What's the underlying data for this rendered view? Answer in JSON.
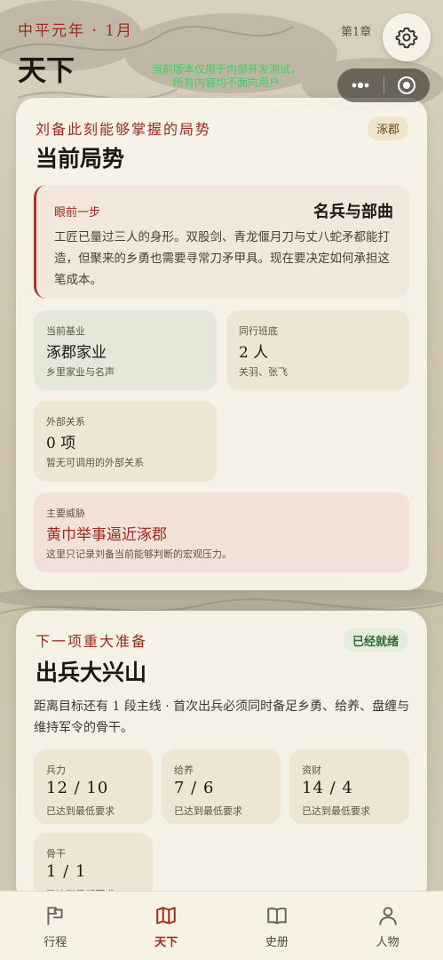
{
  "header": {
    "era": "中平元年 · 1月",
    "chapter": "第1章",
    "title": "天下",
    "dev_notice": "当前版本仅用于内部开发测试，\n所有内容均不面向用户",
    "icons": {
      "settings": "gear-icon",
      "more": "more-dots-icon",
      "close": "mini-program-close-icon"
    }
  },
  "situation": {
    "kicker": "刘备此刻能够掌握的局势",
    "title": "当前局势",
    "badge": "涿郡",
    "next_step": {
      "label": "眼前一步",
      "title": "名兵与部曲",
      "text": "工匠已量过三人的身形。双股剑、青龙偃月刀与丈八蛇矛都能打造，但聚来的乡勇也需要寻常刀矛甲具。现在要决定如何承担这笔成本。"
    },
    "base": {
      "label": "当前基业",
      "value": "涿郡家业",
      "sub": "乡里家业与名声"
    },
    "companions": {
      "label": "同行班底",
      "value": "2 人",
      "sub": "关羽、张飞"
    },
    "relations": {
      "label": "外部关系",
      "value": "0 项",
      "sub": "暂无可调用的外部关系"
    },
    "threat": {
      "label": "主要威胁",
      "value": "黄巾举事逼近涿郡",
      "sub": "这里只记录刘备当前能够判断的宏观压力。"
    }
  },
  "preparation": {
    "kicker": "下一项重大准备",
    "title": "出兵大兴山",
    "badge": "已经就绪",
    "desc": "距离目标还有 1 段主线 · 首次出兵必须同时备足乡勇、给养、盘缠与维持军令的骨干。",
    "resources": [
      {
        "label": "兵力",
        "value": "12 / 10",
        "sub": "已达到最低要求"
      },
      {
        "label": "给养",
        "value": "7 / 6",
        "sub": "已达到最低要求"
      },
      {
        "label": "资财",
        "value": "14 / 4",
        "sub": "已达到最低要求"
      },
      {
        "label": "骨干",
        "value": "1 / 1",
        "sub": "已达到最低要求"
      }
    ]
  },
  "tabbar": {
    "tabs": [
      {
        "label": "行程",
        "icon": "flag-icon",
        "active": false
      },
      {
        "label": "天下",
        "icon": "map-icon",
        "active": true
      },
      {
        "label": "史册",
        "icon": "book-icon",
        "active": false
      },
      {
        "label": "人物",
        "icon": "person-icon",
        "active": false
      }
    ]
  },
  "colors": {
    "accent": "#9b2a1f",
    "ready": "#2f6a3a",
    "inactive_icon": "#6a6259"
  }
}
